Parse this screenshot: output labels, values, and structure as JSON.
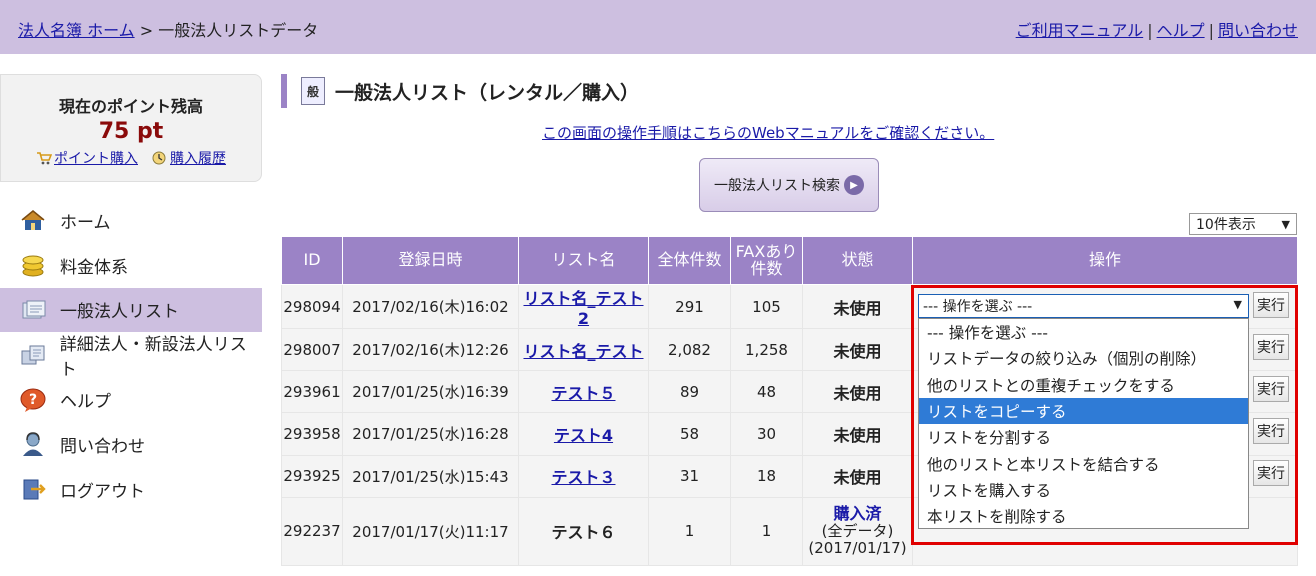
{
  "breadcrumb": {
    "home": "法人名簿 ホーム",
    "sep": " > ",
    "current": "一般法人リストデータ"
  },
  "top_links": [
    "ご利用マニュアル",
    "ヘルプ",
    "問い合わせ"
  ],
  "points": {
    "label": "現在のポイント残高",
    "value": "75 pt",
    "buy": "ポイント購入",
    "history": "購入履歴"
  },
  "nav": [
    {
      "label": "ホーム",
      "icon": "house-icon"
    },
    {
      "label": "料金体系",
      "icon": "coins-icon"
    },
    {
      "label": "一般法人リスト",
      "icon": "list-icon"
    },
    {
      "label": "詳細法人・新設法人リスト",
      "icon": "detail-list-icon"
    },
    {
      "label": "ヘルプ",
      "icon": "help-icon"
    },
    {
      "label": "問い合わせ",
      "icon": "support-icon"
    },
    {
      "label": "ログアウト",
      "icon": "logout-icon"
    }
  ],
  "page": {
    "heading": "一般法人リスト（レンタル／購入）",
    "heading_icon_text": "般",
    "manual_link": "この画面の操作手順はこちらのWebマニュアルをご確認ください。",
    "search_button": "一般法人リスト検索",
    "per_page": "10件表示"
  },
  "table": {
    "headers": [
      "ID",
      "登録日時",
      "リスト名",
      "全体件数",
      "FAXあり件数",
      "状態",
      "操作"
    ],
    "fax_header_line1": "FAXあり",
    "fax_header_line2": "件数",
    "exec_label": "実行",
    "rows": [
      {
        "id": "298094",
        "date": "2017/02/16(木)16:02",
        "name": "リスト名_テスト2",
        "total": "291",
        "fax": "105",
        "state": "未使用"
      },
      {
        "id": "298007",
        "date": "2017/02/16(木)12:26",
        "name": "リスト名_テスト",
        "total": "2,082",
        "fax": "1,258",
        "state": "未使用"
      },
      {
        "id": "293961",
        "date": "2017/01/25(水)16:39",
        "name": "テスト５",
        "total": "89",
        "fax": "48",
        "state": "未使用"
      },
      {
        "id": "293958",
        "date": "2017/01/25(水)16:28",
        "name": "テスト4",
        "total": "58",
        "fax": "30",
        "state": "未使用"
      },
      {
        "id": "293925",
        "date": "2017/01/25(水)15:43",
        "name": "テスト３",
        "total": "31",
        "fax": "18",
        "state": "未使用"
      },
      {
        "id": "292237",
        "date": "2017/01/17(火)11:17",
        "name": "テスト６",
        "total": "1",
        "fax": "1",
        "state_purchased": "購入済",
        "state_sub1": "(全データ)",
        "state_sub2": "(2017/01/17)"
      }
    ]
  },
  "dropdown": {
    "selected": "--- 操作を選ぶ ---",
    "options": [
      "--- 操作を選ぶ ---",
      "リストデータの絞り込み（個別の削除）",
      "他のリストとの重複チェックをする",
      "リストをコピーする",
      "リストを分割する",
      "他のリストと本リストを結合する",
      "リストを購入する",
      "本リストを削除する"
    ],
    "highlighted_index": 3,
    "highlight_color": "#2f7bd6",
    "callout_color": "#e00000"
  }
}
